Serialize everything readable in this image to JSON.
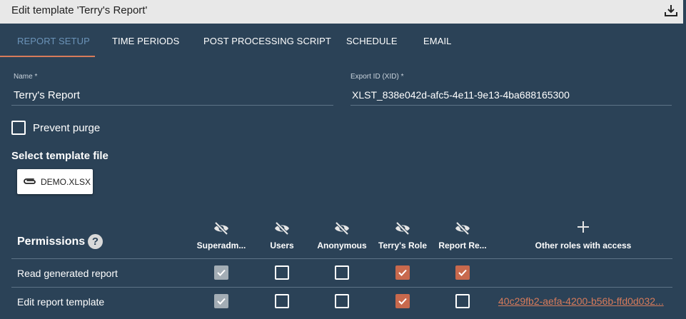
{
  "window": {
    "title": "Edit template 'Terry's Report'",
    "download_icon": "download-icon"
  },
  "tabs": [
    {
      "label": "REPORT SETUP",
      "active": true
    },
    {
      "label": "TIME PERIODS",
      "active": false
    },
    {
      "label": "POST PROCESSING SCRIPT",
      "active": false
    },
    {
      "label": "SCHEDULE",
      "active": false
    },
    {
      "label": "EMAIL",
      "active": false
    }
  ],
  "form": {
    "name": {
      "label": "Name *",
      "value": "Terry's Report"
    },
    "export_id": {
      "label": "Export ID (XID) *",
      "value": "XLST_838e042d-afc5-4e11-9e13-4ba688165300"
    },
    "prevent_purge": {
      "label": "Prevent purge",
      "checked": false
    },
    "template_file": {
      "heading": "Select template file",
      "file_name": "DEMO.XLSX",
      "icon": "paperclip-icon"
    }
  },
  "permissions": {
    "title": "Permissions",
    "help_label": "?",
    "columns": [
      "Superadm...",
      "Users",
      "Anonymous",
      "Terry's Role",
      "Report Re..."
    ],
    "add_column_label": "Other roles with access",
    "rows": [
      {
        "label": "Read generated report",
        "states": [
          "disabled-checked",
          "unchecked",
          "unchecked",
          "checked",
          "checked"
        ],
        "other": ""
      },
      {
        "label": "Edit report template",
        "states": [
          "disabled-checked",
          "unchecked",
          "unchecked",
          "checked",
          "unchecked"
        ],
        "other": "40c29fb2-aefa-4200-b56b-ffd0d032..."
      }
    ]
  },
  "colors": {
    "background": "#2b4257",
    "accent": "#d77b5b",
    "active_tab": "#6b93b8",
    "checked": "#c8694d",
    "disabled": "#a3adb5"
  }
}
